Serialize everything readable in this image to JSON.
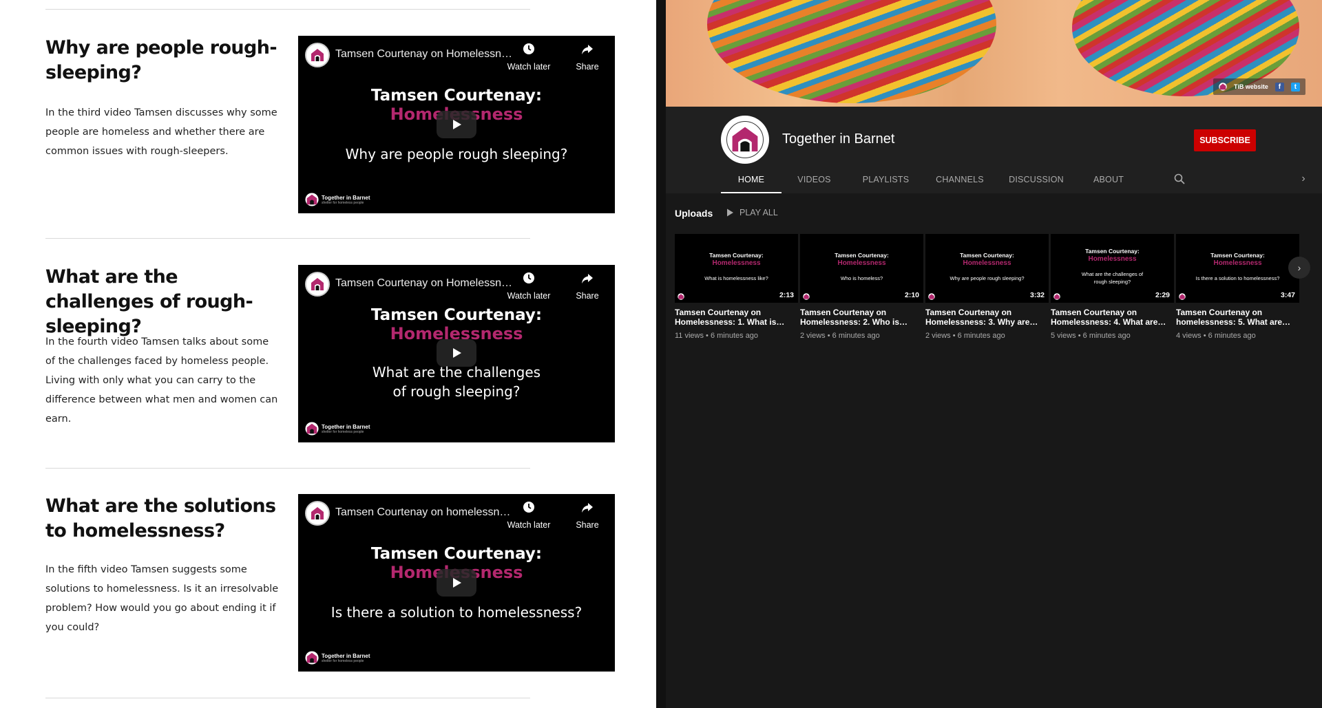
{
  "article": {
    "sections": [
      {
        "title": "Why are people rough-sleeping?",
        "text": "In the third video Tamsen discusses why some people are homeless and whether there are common issues with rough-sleepers.",
        "video": {
          "title": "Tamsen Courtenay on Homelessne...",
          "brand_line1": "Tamsen Courtenay:",
          "brand_line2": "Homelessness",
          "caption": "Why are people rough sleeping?",
          "watch_later": "Watch later",
          "share": "Share",
          "logo_text": "Together in Barnet",
          "logo_sub": "shelter for homeless people"
        }
      },
      {
        "title": "What are the challenges of rough-sleeping?",
        "text": "In the fourth video Tamsen talks about some of the challenges faced by homeless people. Living with only what you can carry to the difference between what men and women can earn.",
        "video": {
          "title": "Tamsen Courtenay on Homelessne...",
          "brand_line1": "Tamsen Courtenay:",
          "brand_line2": "Homelessness",
          "caption": "What are the challenges of rough sleeping?",
          "watch_later": "Watch later",
          "share": "Share",
          "logo_text": "Together in Barnet",
          "logo_sub": "shelter for homeless people"
        }
      },
      {
        "title": "What are the solutions to homelessness?",
        "text": "In the fifth video Tamsen suggests some solutions to homelessness. Is it an irresolvable problem? How would you go about ending it if you could?",
        "video": {
          "title": "Tamsen Courtenay on homelessnes...",
          "brand_line1": "Tamsen Courtenay:",
          "brand_line2": "Homelessness",
          "caption": "Is there a solution to homelessness?",
          "watch_later": "Watch later",
          "share": "Share",
          "logo_text": "Together in Barnet",
          "logo_sub": "shelter for homeless people"
        }
      }
    ]
  },
  "channel": {
    "banner_link": "TiB website",
    "name": "Together in Barnet",
    "subscribe": "SUBSCRIBE",
    "tabs": [
      "HOME",
      "VIDEOS",
      "PLAYLISTS",
      "CHANNELS",
      "DISCUSSION",
      "ABOUT"
    ],
    "active_tab": "HOME",
    "uploads_label": "Uploads",
    "play_all": "PLAY ALL",
    "videos": [
      {
        "thumb_line1": "Tamsen Courtenay:",
        "thumb_line2": "Homelessness",
        "thumb_caption": "What is homelessness like?",
        "duration": "2:13",
        "title": "Tamsen Courtenay on Homelessness: 1. What is…",
        "meta": "11 views • 6 minutes ago"
      },
      {
        "thumb_line1": "Tamsen Courtenay:",
        "thumb_line2": "Homelessness",
        "thumb_caption": "Who is homeless?",
        "duration": "2:10",
        "title": "Tamsen Courtenay on Homelessness: 2. Who is…",
        "meta": "2 views • 6 minutes ago"
      },
      {
        "thumb_line1": "Tamsen Courtenay:",
        "thumb_line2": "Homelessness",
        "thumb_caption": "Why are people rough sleeping?",
        "duration": "3:32",
        "title": "Tamsen Courtenay on Homelessness: 3. Why are…",
        "meta": "2 views • 6 minutes ago"
      },
      {
        "thumb_line1": "Tamsen Courtenay:",
        "thumb_line2": "Homelessness",
        "thumb_caption": "What are the challenges of rough sleeping?",
        "duration": "2:29",
        "title": "Tamsen Courtenay on Homelessness: 4. What are…",
        "meta": "5 views • 6 minutes ago"
      },
      {
        "thumb_line1": "Tamsen Courtenay:",
        "thumb_line2": "Homelessness",
        "thumb_caption": "Is there a solution to homelessness?",
        "duration": "3:47",
        "title": "Tamsen Courtenay on homelessness: 5. What are…",
        "meta": "4 views • 6 minutes ago"
      }
    ]
  },
  "colors": {
    "accent_magenta": "#b3286e",
    "subscribe_red": "#cc0000",
    "yt_background": "#181818"
  },
  "icons": [
    "clock-icon",
    "share-arrow-icon",
    "play-icon",
    "house-logo-icon",
    "search-icon",
    "chevron-right-icon",
    "facebook-icon",
    "twitter-icon"
  ]
}
